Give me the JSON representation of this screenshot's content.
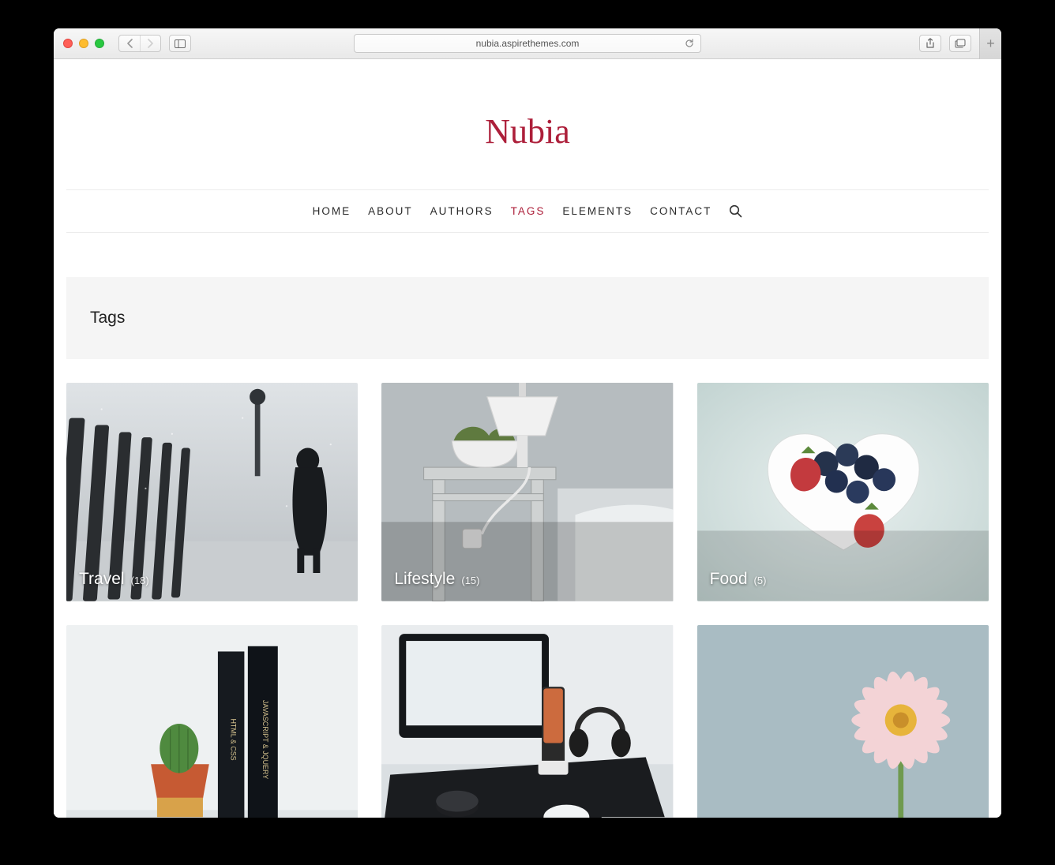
{
  "browser": {
    "url": "nubia.aspirethemes.com"
  },
  "site": {
    "title": "Nubia",
    "nav": [
      {
        "label": "HOME",
        "active": false
      },
      {
        "label": "ABOUT",
        "active": false
      },
      {
        "label": "AUTHORS",
        "active": false
      },
      {
        "label": "TAGS",
        "active": true
      },
      {
        "label": "ELEMENTS",
        "active": false
      },
      {
        "label": "CONTACT",
        "active": false
      }
    ]
  },
  "page_title": "Tags",
  "tags": [
    {
      "label": "Travel",
      "count": "(18)"
    },
    {
      "label": "Lifestyle",
      "count": "(15)"
    },
    {
      "label": "Food",
      "count": "(5)"
    },
    {
      "label": "",
      "count": ""
    },
    {
      "label": "",
      "count": ""
    },
    {
      "label": "",
      "count": ""
    }
  ]
}
